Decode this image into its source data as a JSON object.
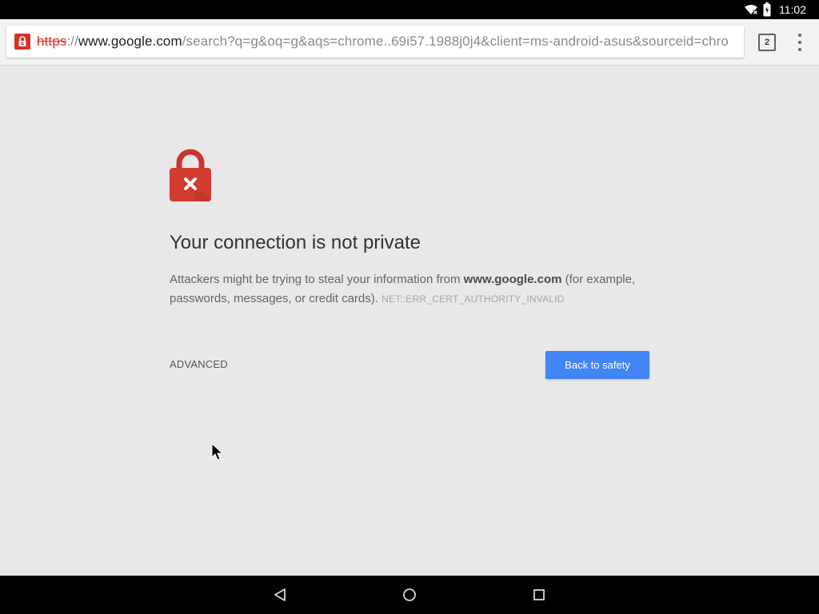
{
  "status_bar": {
    "time": "11:02",
    "icons": [
      "wifi-icon",
      "battery-icon"
    ]
  },
  "toolbar": {
    "url_scheme": "https",
    "url_separator": "://",
    "url_host": "www.google.com",
    "url_rest": "/search?q=g&oq=g&aqs=chrome..69i57.1988j0j4&client=ms-android-asus&sourceid=chro",
    "tab_count": "2",
    "security_icon": "broken-lock-icon",
    "menu_icon": "overflow-menu-icon"
  },
  "interstitial": {
    "icon": "red-lock-icon",
    "heading": "Your connection is not private",
    "explanation_prefix": "Attackers might be trying to steal your information from ",
    "hostname": "www.google.com",
    "explanation_suffix": " (for example, passwords, messages, or credit cards). ",
    "error_code": "NET::ERR_CERT_AUTHORITY_INVALID",
    "advanced_label": "ADVANCED",
    "back_label": "Back to safety"
  },
  "nav_bar": {
    "buttons": [
      "back-icon",
      "home-icon",
      "recents-icon"
    ]
  },
  "colors": {
    "accent_button": "#4285f4",
    "error_red": "#d93025",
    "lock_red": "#c9362e",
    "page_background": "#e8e8e8"
  }
}
